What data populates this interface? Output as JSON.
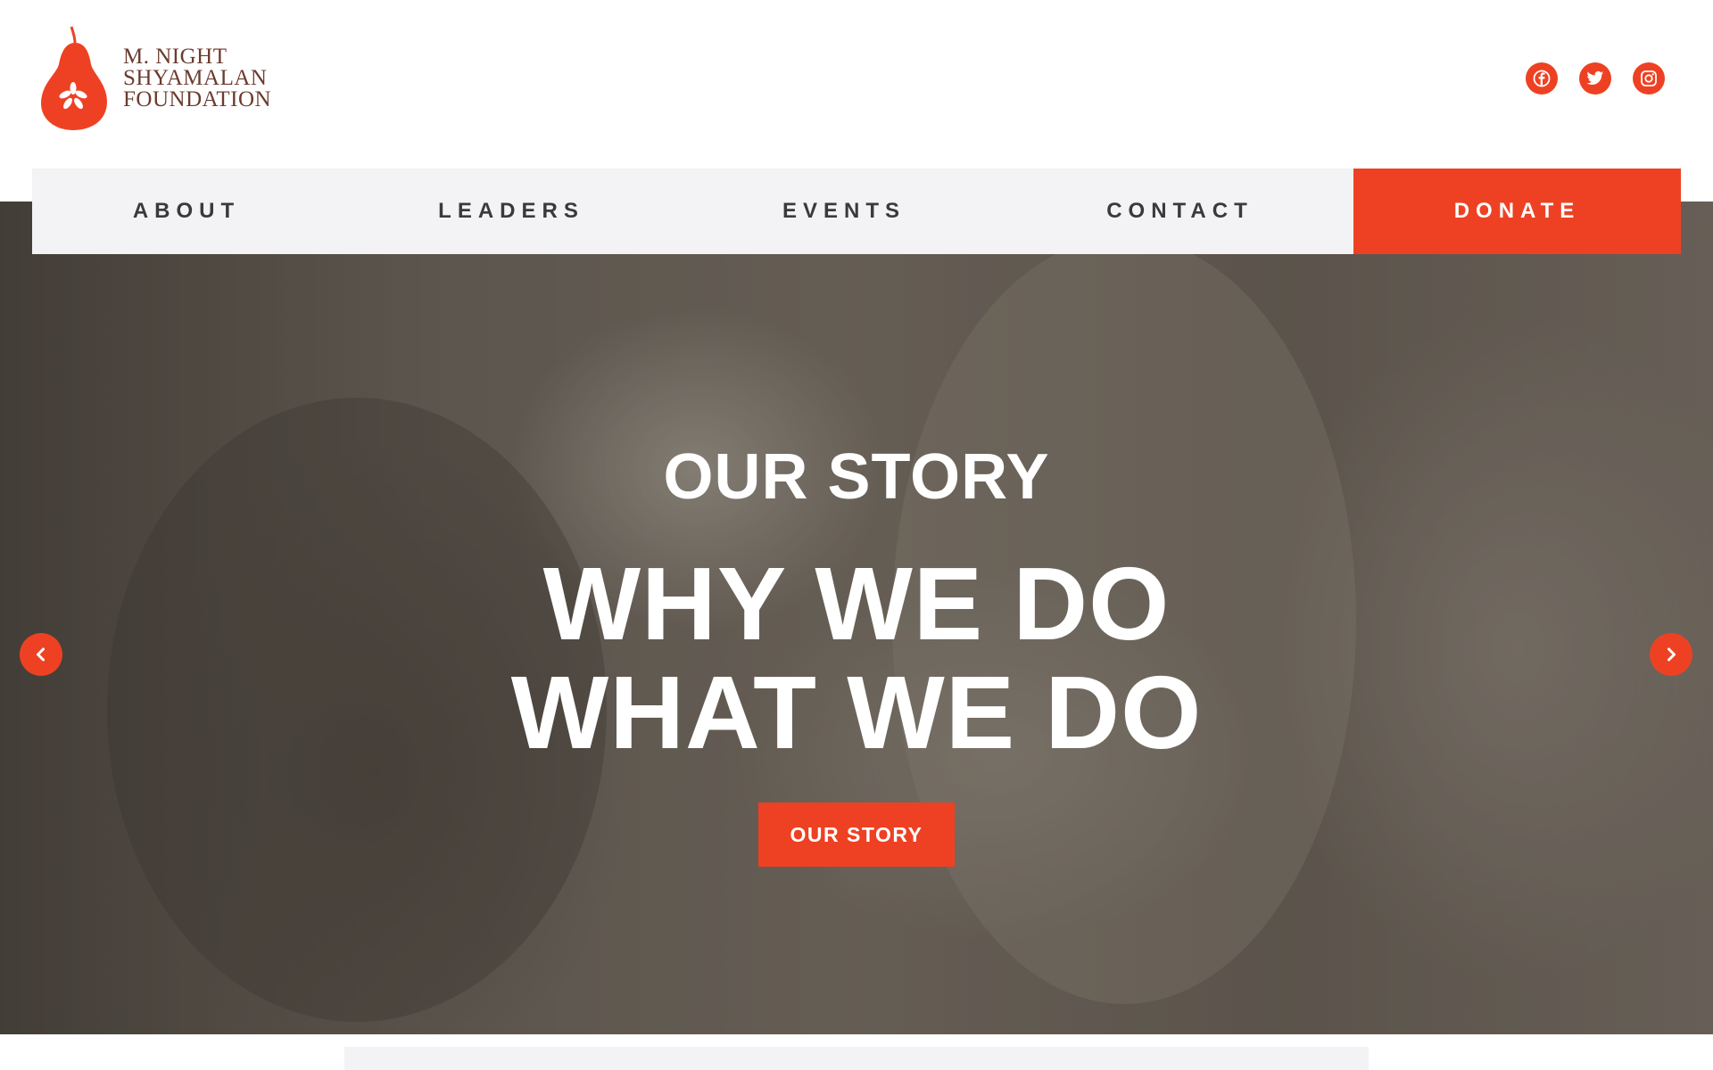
{
  "brand": {
    "line1": "M. NIGHT",
    "line2": "SHYAMALAN",
    "line3": "FOUNDATION",
    "logo_icon": "pear-logo-icon",
    "color": "#ee4123",
    "text_color": "#6b3b2e"
  },
  "social": [
    {
      "name": "facebook",
      "icon": "facebook-icon"
    },
    {
      "name": "twitter",
      "icon": "twitter-icon"
    },
    {
      "name": "instagram",
      "icon": "instagram-icon"
    }
  ],
  "nav": {
    "items": [
      {
        "label": "ABOUT"
      },
      {
        "label": "LEADERS"
      },
      {
        "label": "EVENTS"
      },
      {
        "label": "CONTACT"
      }
    ],
    "donate_label": "DONATE"
  },
  "hero": {
    "eyebrow": "OUR STORY",
    "title_line1": "WHY WE DO",
    "title_line2": "WHAT WE DO",
    "cta_label": "OUR STORY",
    "prev_icon": "chevron-left-icon",
    "next_icon": "chevron-right-icon"
  },
  "colors": {
    "accent": "#ee4123",
    "nav_bg": "#f3f3f5",
    "nav_text": "#3a3a3a"
  }
}
